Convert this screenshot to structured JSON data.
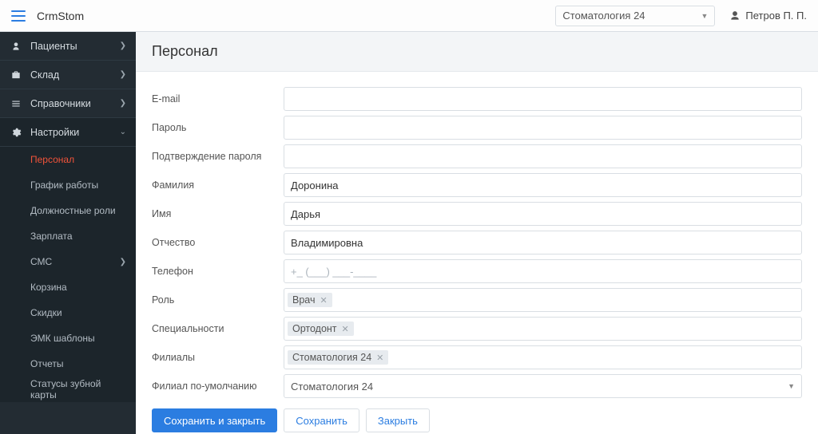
{
  "topbar": {
    "brand": "CrmStom",
    "org_selected": "Стоматология 24",
    "user_name": "Петров П. П."
  },
  "sidebar": {
    "items": [
      {
        "label": "Пациенты",
        "icon": "users",
        "expandable": true
      },
      {
        "label": "Склад",
        "icon": "briefcase",
        "expandable": true
      },
      {
        "label": "Справочники",
        "icon": "list",
        "expandable": true
      },
      {
        "label": "Настройки",
        "icon": "gear",
        "expandable": true,
        "expanded": true
      }
    ],
    "settings_children": [
      {
        "label": "Персонал",
        "active": true
      },
      {
        "label": "График работы"
      },
      {
        "label": "Должностные роли"
      },
      {
        "label": "Зарплата"
      },
      {
        "label": "СМС",
        "expandable": true
      },
      {
        "label": "Корзина"
      },
      {
        "label": "Скидки"
      },
      {
        "label": "ЭМК шаблоны"
      },
      {
        "label": "Отчеты"
      },
      {
        "label": "Статусы зубной карты"
      }
    ]
  },
  "page": {
    "title": "Персонал"
  },
  "form": {
    "labels": {
      "email": "E-mail",
      "password": "Пароль",
      "password_confirm": "Подтверждение пароля",
      "last_name": "Фамилия",
      "first_name": "Имя",
      "patronymic": "Отчество",
      "phone": "Телефон",
      "role": "Роль",
      "specialties": "Специальности",
      "branches": "Филиалы",
      "default_branch": "Филиал по-умолчанию"
    },
    "values": {
      "email": "",
      "password": "",
      "password_confirm": "",
      "last_name": "Доронина",
      "first_name": "Дарья",
      "patronymic": "Владимировна",
      "phone": "",
      "phone_placeholder": "+_ (___) ___-____",
      "role_tag": "Врач",
      "specialty_tag": "Ортодонт",
      "branch_tag": "Стоматология 24",
      "default_branch": "Стоматология 24"
    },
    "buttons": {
      "save_close": "Сохранить и закрыть",
      "save": "Сохранить",
      "close": "Закрыть"
    }
  }
}
